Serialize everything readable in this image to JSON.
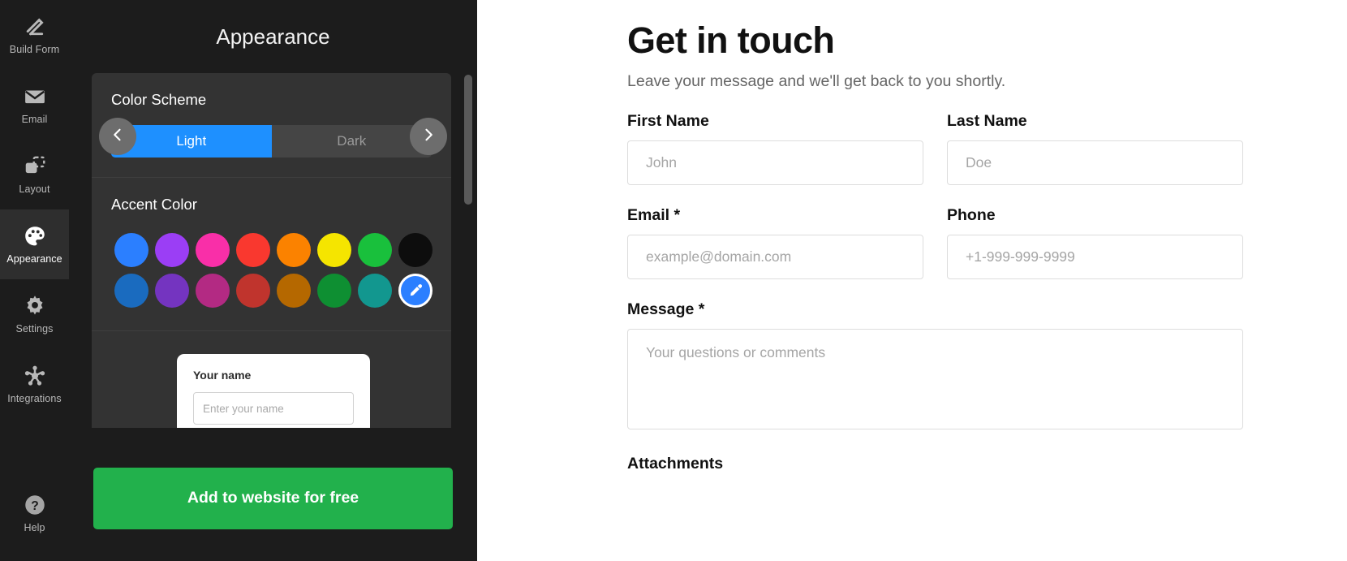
{
  "sidebar": {
    "items": [
      {
        "label": "Build Form",
        "icon": "pencil-icon",
        "active": false
      },
      {
        "label": "Email",
        "icon": "envelope-icon",
        "active": false
      },
      {
        "label": "Layout",
        "icon": "layout-icon",
        "active": false
      },
      {
        "label": "Appearance",
        "icon": "palette-icon",
        "active": true
      },
      {
        "label": "Settings",
        "icon": "gear-icon",
        "active": false
      },
      {
        "label": "Integrations",
        "icon": "hub-icon",
        "active": false
      }
    ],
    "help": {
      "label": "Help",
      "icon": "question-circle-icon"
    }
  },
  "panel": {
    "title": "Appearance",
    "color_scheme": {
      "title": "Color Scheme",
      "options": [
        "Light",
        "Dark"
      ],
      "selected": "Light",
      "selected_bg": "#1e90ff"
    },
    "accent_color": {
      "title": "Accent Color",
      "swatches": [
        "#2b7fff",
        "#9b3ef5",
        "#f92fa8",
        "#f9382f",
        "#fb8200",
        "#f5e500",
        "#19c03c",
        "#0d0d0d",
        "#1a6bbf",
        "#7434c0",
        "#b32a83",
        "#c0342d",
        "#b56800",
        "#0e8f32",
        "#12978f"
      ],
      "custom_button": {
        "icon": "eyedropper-icon",
        "color": "#2b7fff",
        "selected": true
      }
    },
    "preview": {
      "field_label": "Your name",
      "field_placeholder": "Enter your name",
      "prev_icon": "chevron-left-icon",
      "next_icon": "chevron-right-icon"
    },
    "cta": {
      "label": "Add to website for free",
      "color": "#22b14c"
    }
  },
  "form": {
    "title": "Get in touch",
    "subtitle": "Leave your message and we'll get back to you shortly.",
    "fields": [
      {
        "label": "First Name",
        "placeholder": "John",
        "value": ""
      },
      {
        "label": "Last Name",
        "placeholder": "Doe",
        "value": ""
      },
      {
        "label": "Email *",
        "placeholder": "example@domain.com",
        "value": ""
      },
      {
        "label": "Phone",
        "placeholder": "+1-999-999-9999",
        "value": ""
      },
      {
        "label": "Message *",
        "placeholder": "Your questions or comments",
        "value": ""
      },
      {
        "label": "Attachments",
        "placeholder": "",
        "value": ""
      }
    ]
  }
}
